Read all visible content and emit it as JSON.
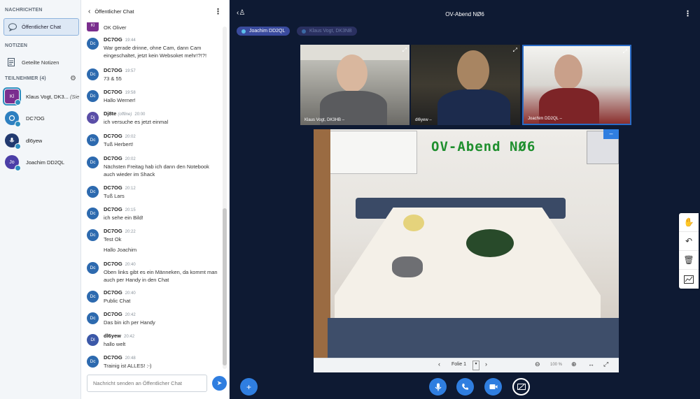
{
  "sidebar": {
    "messages_heading": "NACHRICHTEN",
    "public_chat_label": "Öffentlicher Chat",
    "notes_heading": "NOTIZEN",
    "shared_notes_label": "Geteilte Notizen",
    "participants_heading": "TEILNEHMER (4)",
    "users": [
      {
        "initials": "Kl",
        "name": "Klaus Vogt, DK3...",
        "suffix": "(Sie)",
        "color": "#7a2e8e"
      },
      {
        "initials": "",
        "name": "DC7OG",
        "suffix": "",
        "color": "#2d7fc0"
      },
      {
        "initials": "",
        "name": "dl6yew",
        "suffix": "",
        "color": "#223a70"
      },
      {
        "initials": "Jo",
        "name": "Joachim DD2QL",
        "suffix": "",
        "color": "#4b3ea7"
      }
    ]
  },
  "chat": {
    "title": "Öffentlicher Chat",
    "input_placeholder": "Nachricht senden an Öffentlicher Chat",
    "messages": [
      {
        "author": "",
        "time": "",
        "lines": [
          "OK Oliver"
        ],
        "av": "Kl"
      },
      {
        "author": "DC7OG",
        "time": "19:44",
        "lines": [
          "War gerade drinne, ohne Cam, dann Cam eingeschaltet, jetzt kein Websoket mehr!?!?!"
        ],
        "av": "Dc"
      },
      {
        "author": "DC7OG",
        "time": "19:57",
        "lines": [
          "73 & 55"
        ],
        "av": "Dc"
      },
      {
        "author": "DC7OG",
        "time": "19:58",
        "lines": [
          "Hallo Werner!"
        ],
        "av": "Dc"
      },
      {
        "author": "Dj8te",
        "time": "20:00",
        "offline": "(offline)",
        "lines": [
          "ich versuche es jetzt einmal"
        ],
        "av": "Dj"
      },
      {
        "author": "DC7OG",
        "time": "20:02",
        "lines": [
          "Tuß Herbert!"
        ],
        "av": "Dc"
      },
      {
        "author": "DC7OG",
        "time": "20:02",
        "lines": [
          "Nächsten Freitag hab ich dann den Notebook auch wieder im Shack"
        ],
        "av": "Dc"
      },
      {
        "author": "DC7OG",
        "time": "20:12",
        "lines": [
          "Tuß Lars"
        ],
        "av": "Dc"
      },
      {
        "author": "DC7OG",
        "time": "20:15",
        "lines": [
          "ich sehe ein Bild!"
        ],
        "av": "Dc"
      },
      {
        "author": "DC7OG",
        "time": "20:22",
        "lines": [
          "Test Ok",
          "Hallo Joachim"
        ],
        "av": "Dc"
      },
      {
        "author": "DC7OG",
        "time": "20:40",
        "lines": [
          "Oben links gibt es ein Männeken, da kommt man auch per Handy in den Chat"
        ],
        "av": "Dc"
      },
      {
        "author": "DC7OG",
        "time": "20:40",
        "lines": [
          "Public Chat"
        ],
        "av": "Dc"
      },
      {
        "author": "DC7OG",
        "time": "20:42",
        "lines": [
          "Das bin ich per Handy"
        ],
        "av": "Dc"
      },
      {
        "author": "dl6yew",
        "time": "20:42",
        "lines": [
          "hallo welt"
        ],
        "av": "Dl"
      },
      {
        "author": "DC7OG",
        "time": "20:48",
        "lines": [
          "Trainig ist ALLES! :-)"
        ],
        "av": "Dc"
      }
    ]
  },
  "main": {
    "title": "OV-Abend NØ6",
    "talkers": [
      "Joachim DD2QL",
      "Klaus Vogt, DK3NB"
    ],
    "videos": [
      {
        "label": "Klaus Vogt, DK3HB –"
      },
      {
        "label": "dl6yew –"
      },
      {
        "label": "Joachim DD2QL –"
      }
    ],
    "presentation": {
      "slide_title": "OV-Abend NØ6",
      "slide_label": "Folie 1",
      "zoom": "100 %"
    }
  },
  "colors": {
    "accent": "#2f7ee0",
    "main_bg": "#0e1a33",
    "slide_title": "#1f8f2e"
  }
}
